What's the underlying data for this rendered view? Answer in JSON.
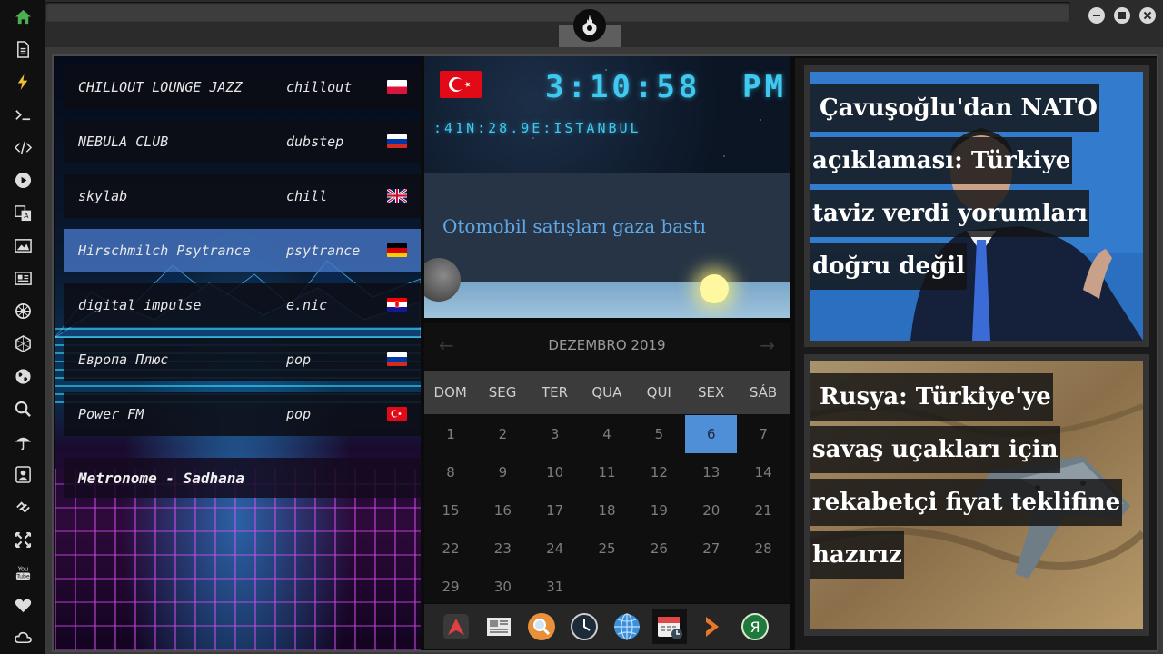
{
  "sidebar": {
    "icons": [
      "home-icon",
      "document-icon",
      "lightning-icon",
      "terminal-icon",
      "code-icon",
      "play-icon",
      "translate-icon",
      "image-icon",
      "news-icon",
      "settings-wheel-icon",
      "hexagon-icon",
      "globe-icon",
      "search-icon",
      "umbrella-icon",
      "contact-icon",
      "link-icon",
      "expand-icon",
      "youtube-icon",
      "heart-icon",
      "cloud-icon"
    ],
    "youtube_label": "You\nTube",
    "accent": "#4caf50"
  },
  "radio": {
    "stations": [
      {
        "name": "CHILLOUT LOUNGE JAZZ",
        "genre": "chillout",
        "flag": "poland"
      },
      {
        "name": "NEBULA CLUB",
        "genre": "dubstep",
        "flag": "russia"
      },
      {
        "name": "skylab",
        "genre": "chill",
        "flag": "uk"
      },
      {
        "name": "Hirschmilch Psytrance",
        "genre": "psytrance",
        "flag": "germany"
      },
      {
        "name": "digital impulse",
        "genre": "e.nic",
        "flag": "croatia"
      },
      {
        "name": "Европа Плюс",
        "genre": "pop",
        "flag": "russia"
      },
      {
        "name": "Power FM",
        "genre": "pop",
        "flag": "turkey"
      }
    ],
    "active_index": 3,
    "now_playing": "Metronome - Sadhana"
  },
  "clock": {
    "time": "3:10:58",
    "ampm": "PM",
    "coords": ":41N:28.9E:ISTANBUL",
    "headline": "Otomobil satışları gaza bastı",
    "color": "#3fc9f0"
  },
  "calendar": {
    "title": "DEZEMBRO 2019",
    "prev": "←",
    "next": "→",
    "weekdays": [
      "DOM",
      "SEG",
      "TER",
      "QUA",
      "QUI",
      "SEX",
      "SÁB"
    ],
    "days": [
      1,
      2,
      3,
      4,
      5,
      6,
      7,
      8,
      9,
      10,
      11,
      12,
      13,
      14,
      15,
      16,
      17,
      18,
      19,
      20,
      21,
      22,
      23,
      24,
      25,
      26,
      27,
      28,
      29,
      30,
      31
    ],
    "today": 6,
    "today_color": "#4f8fd8"
  },
  "dock": {
    "items": [
      "arrow-app-icon",
      "news-app-icon",
      "search-app-icon",
      "clock-app-icon",
      "globe-app-icon",
      "calendar-app-icon",
      "forward-app-icon",
      "yandex-app-icon"
    ],
    "yandex_label": "Я"
  },
  "news": [
    {
      "lines": [
        "Çavuşoğlu'dan NATO",
        "açıklaması: Türkiye",
        "taviz verdi yorumları",
        "doğru değil"
      ]
    },
    {
      "lines": [
        "Rusya: Türkiye'ye",
        "savaş uçakları için",
        "rekabetçi fiyat teklifine",
        "hazırız"
      ]
    }
  ]
}
